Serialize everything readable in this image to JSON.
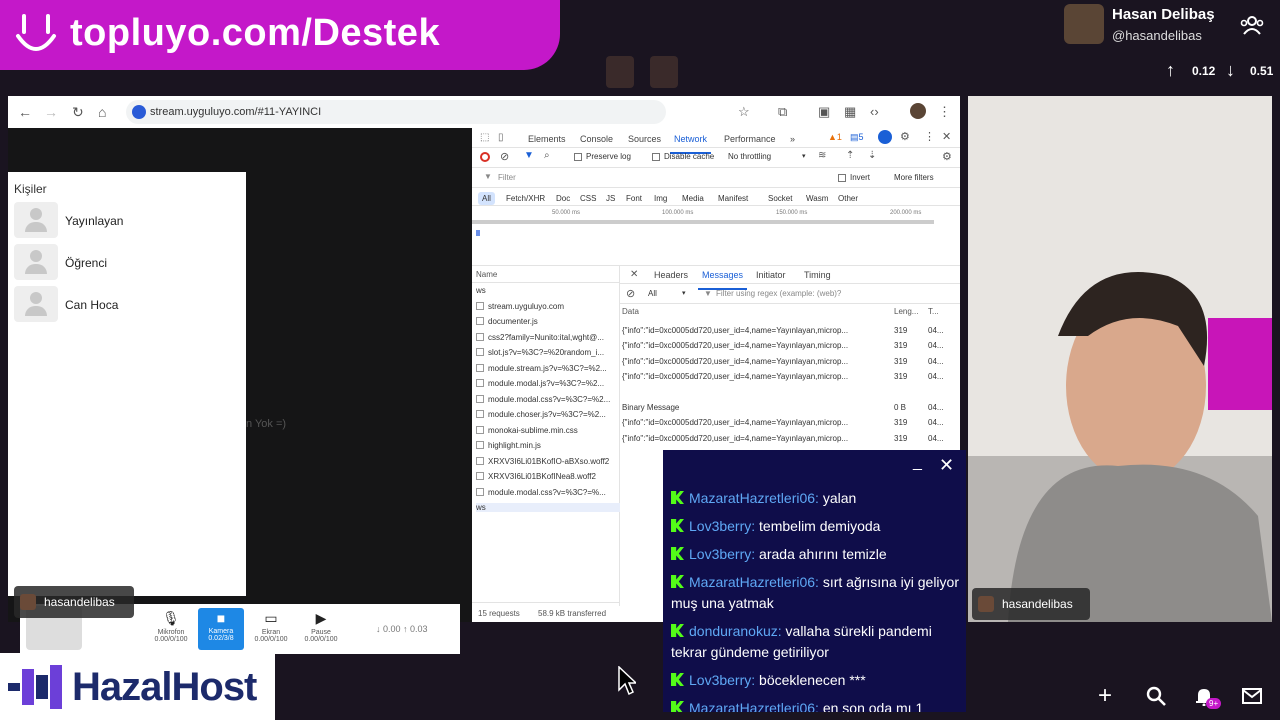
{
  "banner": {
    "text": "topluyo.com/Destek"
  },
  "profile": {
    "name": "Hasan Delibaş",
    "handle": "@hasandelibas",
    "up": "0.12",
    "down": "0.51"
  },
  "browser": {
    "url": "stream.uyguluyo.com/#11-YAYINCI",
    "people_title": "Kişiler",
    "people": [
      "Yayınlayan",
      "Öğrenci",
      "Can Hoca"
    ],
    "ghost_text": "n Yok =)",
    "controls": [
      {
        "label": "Mikrofon",
        "sub": "0.00/0/100",
        "icon": "mic-icon",
        "glyph": "🎙"
      },
      {
        "label": "Kamera",
        "sub": "0.02/3/8",
        "icon": "camera-icon",
        "glyph": "■",
        "active": true
      },
      {
        "label": "Ekran",
        "sub": "0.00/0/100",
        "icon": "screen-icon",
        "glyph": "▭"
      },
      {
        "label": "Pause",
        "sub": "0.00/0/100",
        "icon": "pause-icon",
        "glyph": "▶"
      }
    ],
    "bandwidth": "↓ 0.00 ↑ 0.03",
    "host_name": "hasandelibas"
  },
  "devtools": {
    "tabs": [
      "Elements",
      "Console",
      "Sources",
      "Network",
      "Performance",
      "»"
    ],
    "selected_tab": "Network",
    "warn_count": "1",
    "msg_count": "5",
    "preserve_log": "Preserve log",
    "disable_cache": "Disable cache",
    "throttle": "No throttling",
    "filter_placeholder": "Filter",
    "invert": "Invert",
    "more_filters": "More filters",
    "type_filters": [
      "All",
      "Fetch/XHR",
      "Doc",
      "CSS",
      "JS",
      "Font",
      "Img",
      "Media",
      "Manifest",
      "Socket",
      "Wasm",
      "Other"
    ],
    "timeline": [
      "50.000 ms",
      "100.000 ms",
      "150.000 ms",
      "200.000 ms"
    ],
    "name_header": "Name",
    "requests": [
      "ws",
      "stream.uyguluyo.com",
      "documenter.js",
      "css2?family=Nunito:ital,wght@...",
      "slot.js?v=%3C?=%20random_i...",
      "module.stream.js?v=%3C?=%2...",
      "module.modal.js?v=%3C?=%2...",
      "module.modal.css?v=%3C?=%2...",
      "module.choser.js?v=%3C?=%2...",
      "monokai-sublime.min.css",
      "highlight.min.js",
      "XRXV3I6Li01BKofIO-aBXso.woff2",
      "XRXV3I6Li01BKofINea8.woff2",
      "module.modal.css?v=%3C?=%...",
      "ws"
    ],
    "detail_tabs": [
      "Headers",
      "Messages",
      "Initiator",
      "Timing"
    ],
    "detail_selected": "Messages",
    "msg_filter_all": "All",
    "msg_filter_placeholder": "Filter using regex (example: (web)?",
    "msg_headers": {
      "data": "Data",
      "length": "Leng...",
      "time": "T..."
    },
    "messages": [
      {
        "data": "{\"info\":\"id=0xc0005dd720,user_id=4,name=Yayınlayan,microp...",
        "len": "319",
        "time": "04..."
      },
      {
        "data": "{\"info\":\"id=0xc0005dd720,user_id=4,name=Yayınlayan,microp...",
        "len": "319",
        "time": "04..."
      },
      {
        "data": "{\"info\":\"id=0xc0005dd720,user_id=4,name=Yayınlayan,microp...",
        "len": "319",
        "time": "04..."
      },
      {
        "data": "{\"info\":\"id=0xc0005dd720,user_id=4,name=Yayınlayan,microp...",
        "len": "319",
        "time": "04..."
      },
      {
        "data": "Binary Message",
        "len": "0 B",
        "time": "04..."
      },
      {
        "data": "{\"info\":\"id=0xc0005dd720,user_id=4,name=Yayınlayan,microp...",
        "len": "319",
        "time": "04..."
      },
      {
        "data": "{\"info\":\"id=0xc0005dd720,user_id=4,name=Yayınlayan,microp...",
        "len": "319",
        "time": "04..."
      }
    ],
    "status": {
      "requests": "15 requests",
      "transferred": "58.9 kB transferred"
    }
  },
  "chat": [
    {
      "user": "MazaratHazretleri06:",
      "text": "yalan"
    },
    {
      "user": "Lov3berry:",
      "text": "tembelim demiyoda"
    },
    {
      "user": "Lov3berry:",
      "text": "arada ahırını temizle"
    },
    {
      "user": "MazaratHazretleri06:",
      "text": "sırt ağrısına iyi geliyor muş una yatmak"
    },
    {
      "user": "donduranokuz:",
      "text": "vallaha sürekli pandemi tekrar gündeme getiriliyor"
    },
    {
      "user": "Lov3berry:",
      "text": "böceklenecen ***"
    },
    {
      "user": "MazaratHazretleri06:",
      "text": "en son oda mı 1"
    }
  ],
  "camera": {
    "name": "hasandelibas"
  },
  "logo": {
    "text": "HazalHost"
  },
  "bottom_icons": [
    "plus-icon",
    "search-icon",
    "bell-icon",
    "mail-icon"
  ],
  "notif_badge": "9+",
  "colors": {
    "brand": "#c418c9",
    "chat_bg": "#0f0d4a",
    "chat_user": "#5fa8f5",
    "kick_green": "#53fc18",
    "devtools_accent": "#1a5fd6"
  }
}
